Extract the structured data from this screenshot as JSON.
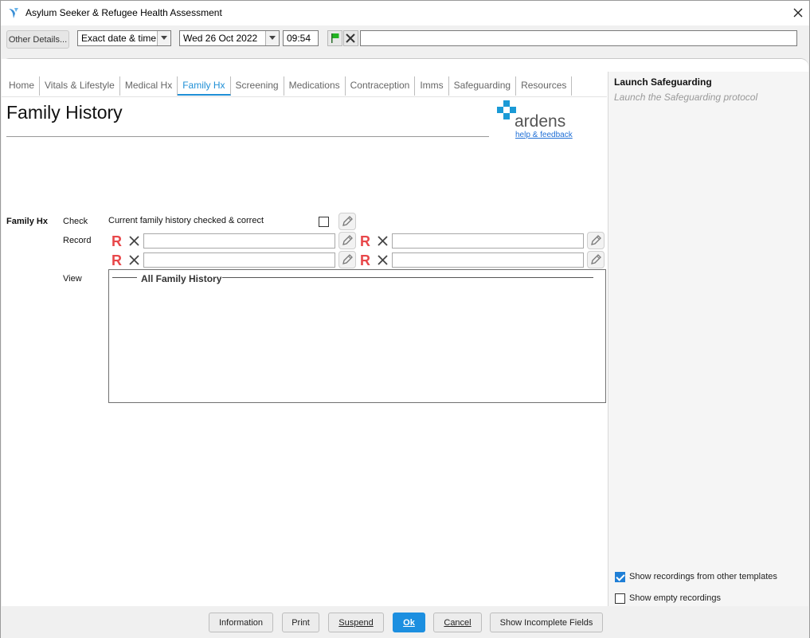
{
  "window": {
    "title": "Asylum Seeker & Refugee Health Assessment",
    "app_icon": "ardens-swift-icon",
    "close_icon": "close-icon"
  },
  "toolbar": {
    "other_details_label": "Other Details...",
    "date_mode": "Exact date & time",
    "date_value": "Wed 26 Oct 2022",
    "time_value": "09:54",
    "note_value": "",
    "flag_icon": "flag-icon",
    "clear_icon": "close-icon"
  },
  "tabs": [
    {
      "label": "Home"
    },
    {
      "label": "Vitals & Lifestyle"
    },
    {
      "label": "Medical Hx"
    },
    {
      "label": "Family Hx",
      "active": true
    },
    {
      "label": "Screening"
    },
    {
      "label": "Medications"
    },
    {
      "label": "Contraception"
    },
    {
      "label": "Imms"
    },
    {
      "label": "Safeguarding"
    },
    {
      "label": "Resources"
    }
  ],
  "page": {
    "title": "Family History",
    "logo_text": "ardens",
    "help_link": "help & feedback"
  },
  "family_hx": {
    "section_label": "Family Hx",
    "check_label": "Check",
    "check_text": "Current family history checked & correct",
    "check_checked": false,
    "record_label": "Record",
    "record_fields": [
      "",
      "",
      "",
      ""
    ],
    "view_label": "View",
    "view_title": "All Family History"
  },
  "sidepanel": {
    "title": "Launch Safeguarding",
    "subtitle": "Launch the Safeguarding protocol",
    "show_other_templates": "Show recordings from other templates",
    "show_other_templates_checked": true,
    "show_empty": "Show empty recordings",
    "show_empty_checked": false
  },
  "footer": {
    "information": "Information",
    "print": "Print",
    "suspend": "Suspend",
    "ok": "Ok",
    "cancel": "Cancel",
    "show_incomplete": "Show Incomplete Fields"
  },
  "colors": {
    "accent": "#1f8fd6",
    "ok_button": "#1c8fe0",
    "r_icon": "#e8474a",
    "logo_blue": "#1b9ad6",
    "flag_green": "#22b322"
  }
}
